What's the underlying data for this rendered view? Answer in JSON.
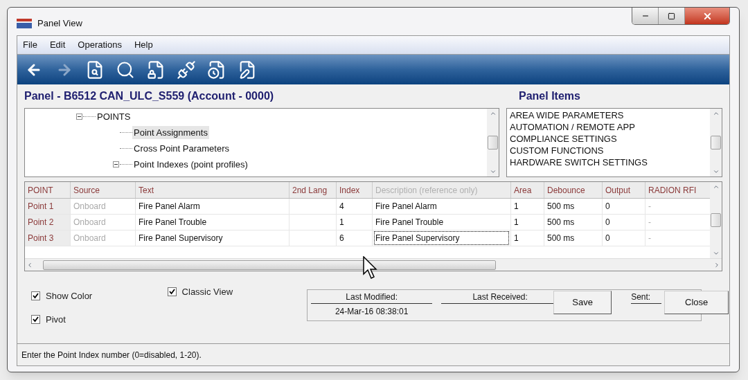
{
  "window": {
    "title": "Panel View"
  },
  "menu": [
    "File",
    "Edit",
    "Operations",
    "Help"
  ],
  "toolbar": [
    {
      "kind": "back",
      "disabled": false
    },
    {
      "kind": "forward",
      "disabled": true
    },
    {
      "kind": "preview",
      "disabled": false
    },
    {
      "kind": "search",
      "disabled": false
    },
    {
      "kind": "lock",
      "disabled": false
    },
    {
      "kind": "connect",
      "disabled": false
    },
    {
      "kind": "history",
      "disabled": false
    },
    {
      "kind": "edit",
      "disabled": false
    }
  ],
  "panel_title": "Panel - B6512 CAN_ULC_S559 (Account - 0000)",
  "panel_items_title": "Panel Items",
  "tree": [
    {
      "label": "POINTS",
      "expanded": true,
      "selected": false,
      "children": [
        {
          "label": "Point Assignments",
          "selected": true
        },
        {
          "label": "Cross Point Parameters",
          "selected": false
        },
        {
          "label": "Point Indexes (point profiles)",
          "selected": false,
          "expanded": true
        }
      ]
    }
  ],
  "panel_items": [
    "AREA WIDE PARAMETERS",
    "AUTOMATION / REMOTE APP",
    "COMPLIANCE SETTINGS",
    "CUSTOM FUNCTIONS",
    "HARDWARE SWITCH SETTINGS"
  ],
  "table": {
    "columns": [
      {
        "label": "POINT",
        "disabled": false
      },
      {
        "label": "Source",
        "disabled": false
      },
      {
        "label": "Text",
        "disabled": false
      },
      {
        "label": "2nd Lang",
        "disabled": false
      },
      {
        "label": "Index",
        "disabled": false
      },
      {
        "label": "Description (reference only)",
        "disabled": true
      },
      {
        "label": "Area",
        "disabled": false
      },
      {
        "label": "Debounce",
        "disabled": false
      },
      {
        "label": "Output",
        "disabled": false
      },
      {
        "label": "RADION RFI",
        "disabled": false
      }
    ],
    "rows": [
      {
        "cells": [
          "Point 1",
          "Onboard",
          "Fire Panel Alarm",
          "",
          "4",
          "Fire Panel Alarm",
          "1",
          "500 ms",
          "0",
          "-"
        ],
        "description_focused": false
      },
      {
        "cells": [
          "Point 2",
          "Onboard",
          "Fire Panel Trouble",
          "",
          "1",
          "Fire Panel Trouble",
          "1",
          "500 ms",
          "0",
          "-"
        ],
        "description_focused": false
      },
      {
        "cells": [
          "Point 3",
          "Onboard",
          "Fire Panel Supervisory",
          "",
          "6",
          "Fire Panel Supervisory",
          "1",
          "500 ms",
          "0",
          "-"
        ],
        "description_focused": true
      }
    ]
  },
  "options": [
    {
      "label": "Show Color",
      "checked": true
    },
    {
      "label": "Pivot",
      "checked": true
    },
    {
      "label": "Classic View",
      "checked": true
    }
  ],
  "info": {
    "last_modified_label": "Last Modified:",
    "last_modified": "24-Mar-16 08:38:01",
    "last_received_label": "Last Received:",
    "sent_label": "Sent:"
  },
  "buttons": [
    "Save",
    "Close"
  ],
  "status_bar": "Enter the Point Index number (0=disabled, 1-20)."
}
